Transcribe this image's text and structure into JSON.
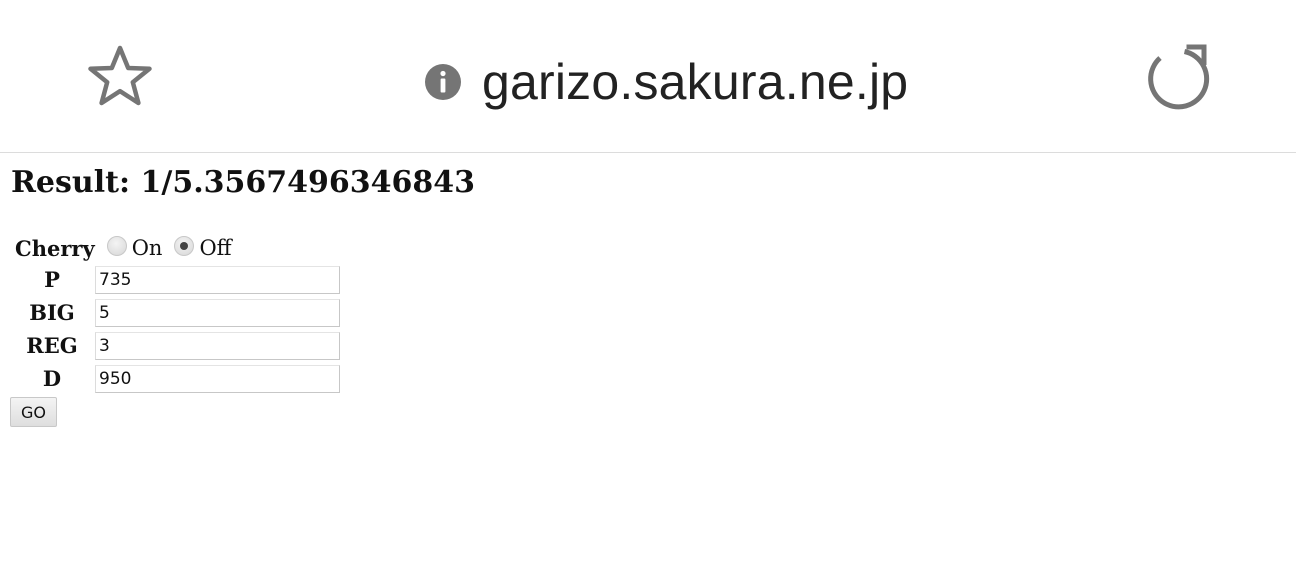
{
  "browser": {
    "url": "garizo.sakura.ne.jp",
    "icons": {
      "bookmark": "star-icon",
      "site_info": "info-icon",
      "reload": "reload-icon"
    }
  },
  "page": {
    "result": "Result: 1/5.3567496346843",
    "cherry": {
      "label": "Cherry",
      "options": [
        {
          "label": "On",
          "checked": false
        },
        {
          "label": "Off",
          "checked": true
        }
      ]
    },
    "fields": [
      {
        "label": "P",
        "value": "735"
      },
      {
        "label": "BIG",
        "value": "5"
      },
      {
        "label": "REG",
        "value": "3"
      },
      {
        "label": "D",
        "value": "950"
      }
    ],
    "submit_label": "GO"
  },
  "colors": {
    "icon_gray": "#757575",
    "url_text": "#222222",
    "divider": "#dcdcdc"
  }
}
